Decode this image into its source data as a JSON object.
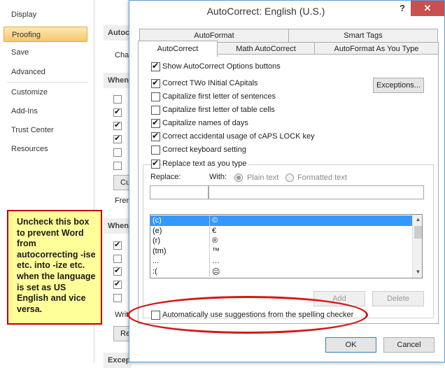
{
  "background_window": {
    "sidebar_items": [
      "Display",
      "Proofing",
      "Save",
      "Advanced",
      "Customize",
      "Add-Ins",
      "Trust Center",
      "Resources"
    ],
    "active_item": "Proofing",
    "section_heads": [
      "Autoc",
      "When",
      "When",
      "Excep"
    ],
    "fragments": {
      "cha": "Cha",
      "cu": "Cu",
      "fren": "Fren",
      "writ": "Writ",
      "re": "Re"
    }
  },
  "callout": {
    "text": "Uncheck this box to prevent Word from autocorrecting -ise etc. into -ize etc. when the language is set as US English and vice versa."
  },
  "dialog": {
    "title": "AutoCorrect: English (U.S.)",
    "help_label": "?",
    "close_label": "✕",
    "tabs_row1": [
      "AutoFormat",
      "Smart Tags"
    ],
    "tabs_row2": [
      "AutoCorrect",
      "Math AutoCorrect",
      "AutoFormat As You Type"
    ],
    "selected_tab": "AutoCorrect",
    "show_options": {
      "label": "Show AutoCorrect Options buttons",
      "checked": true
    },
    "exceptions_button": "Exceptions...",
    "options": [
      {
        "label": "Correct TWo INitial CApitals",
        "checked": true
      },
      {
        "label": "Capitalize first letter of sentences",
        "checked": false
      },
      {
        "label": "Capitalize first letter of table cells",
        "checked": false
      },
      {
        "label": "Capitalize names of days",
        "checked": true
      },
      {
        "label": "Correct accidental usage of cAPS LOCK key",
        "checked": true
      },
      {
        "label": "Correct keyboard setting",
        "checked": false
      }
    ],
    "replace_as_you_type": {
      "label": "Replace text as you type",
      "checked": true
    },
    "replace_label": "Replace:",
    "with_label": "With:",
    "plain_text_label": "Plain text",
    "formatted_text_label": "Formatted text",
    "replace_value": "",
    "with_value": "",
    "list_rows": [
      {
        "replace": "(c)",
        "with": "©",
        "selected": true
      },
      {
        "replace": "(e)",
        "with": "€",
        "selected": false
      },
      {
        "replace": "(r)",
        "with": "®",
        "selected": false
      },
      {
        "replace": "(tm)",
        "with": "™",
        "selected": false
      },
      {
        "replace": "...",
        "with": "…",
        "selected": false
      },
      {
        "replace": ":(",
        "with": "☹",
        "selected": false
      }
    ],
    "add_button": "Add",
    "delete_button": "Delete",
    "spelling_suggestions": {
      "label": "Automatically use suggestions from the spelling checker",
      "checked": false
    },
    "ok_button": "OK",
    "cancel_button": "Cancel"
  },
  "colors": {
    "callout_bg": "#ffff99",
    "highlight_ellipse": "#d11a1a",
    "selection": "#3399ff",
    "active_sidebar": "#f6c66b"
  }
}
